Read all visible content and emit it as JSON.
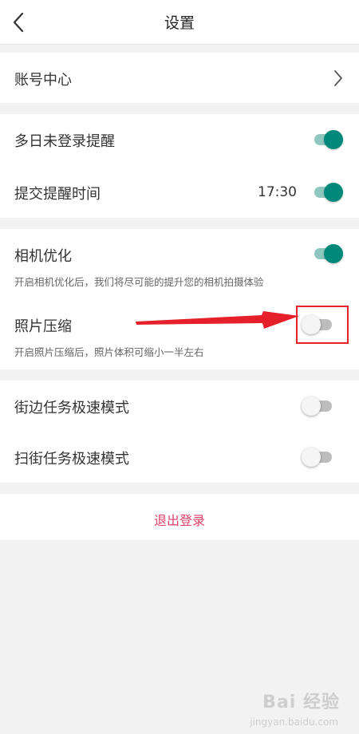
{
  "header": {
    "title": "设置"
  },
  "account": {
    "label": "账号中心"
  },
  "reminders": {
    "multi_day_login": {
      "label": "多日未登录提醒",
      "enabled": true
    },
    "submit_reminder": {
      "label": "提交提醒时间",
      "time": "17:30",
      "enabled": true
    }
  },
  "camera": {
    "optimization": {
      "label": "相机优化",
      "description": "开启相机优化后，我们将尽可能的提升您的相机拍摄体验",
      "enabled": true
    },
    "photo_compression": {
      "label": "照片压缩",
      "description": "开启照片压缩后，照片体积可缩小一半左右",
      "enabled": false
    }
  },
  "speed_modes": {
    "street_side": {
      "label": "街边任务极速模式",
      "enabled": false
    },
    "street_sweep": {
      "label": "扫街任务极速模式",
      "enabled": false
    }
  },
  "logout": {
    "label": "退出登录"
  },
  "annotation": {
    "color": "#e5202a"
  },
  "watermark": {
    "text": "Bai 经验",
    "sub": "jingyan.baidu.com"
  },
  "colors": {
    "accent_on": "#00897b",
    "logout": "#e04168"
  },
  "icons": {
    "back": "chevron-left-icon",
    "account_chevron": "chevron-right-icon"
  }
}
